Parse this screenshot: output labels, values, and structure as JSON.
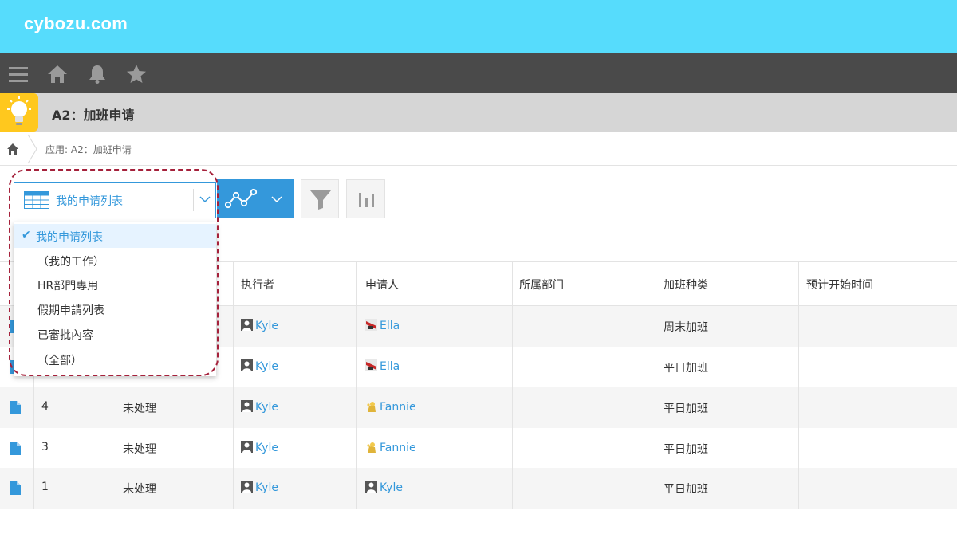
{
  "brand": {
    "logo": "cybozu.com"
  },
  "nav": {
    "icons": [
      "menu-icon",
      "home-icon",
      "bell-icon",
      "star-icon"
    ]
  },
  "app": {
    "title": "A2：加班申请",
    "icon": "lightbulb-icon"
  },
  "breadcrumb": {
    "text": "应用: A2：加班申请"
  },
  "view_selector": {
    "selected": "我的申请列表",
    "options": [
      {
        "label": "我的申请列表",
        "selected": true
      },
      {
        "label": "（我的工作）",
        "selected": false
      },
      {
        "label": "HR部門專用",
        "selected": false
      },
      {
        "label": "假期申請列表",
        "selected": false
      },
      {
        "label": "已審批內容",
        "selected": false
      },
      {
        "label": "（全部）",
        "selected": false
      }
    ]
  },
  "table": {
    "headers": [
      "执行者",
      "申请人",
      "所属部门",
      "加班种类",
      "预计开始时间"
    ],
    "rows": [
      {
        "id": "",
        "status": "",
        "assignee": "Kyle",
        "applicant": "Ella",
        "dept": "",
        "type": "周末加班",
        "start": ""
      },
      {
        "id": "",
        "status": "",
        "assignee": "Kyle",
        "applicant": "Ella",
        "dept": "",
        "type": "平日加班",
        "start": ""
      },
      {
        "id": "4",
        "status": "未处理",
        "assignee": "Kyle",
        "applicant": "Fannie",
        "dept": "",
        "type": "平日加班",
        "start": ""
      },
      {
        "id": "3",
        "status": "未处理",
        "assignee": "Kyle",
        "applicant": "Fannie",
        "dept": "",
        "type": "平日加班",
        "start": ""
      },
      {
        "id": "1",
        "status": "未处理",
        "assignee": "Kyle",
        "applicant": "Kyle",
        "dept": "",
        "type": "平日加班",
        "start": ""
      }
    ]
  },
  "colors": {
    "brand": "#56dcfc",
    "accent": "#3498db",
    "navbar": "#4a4a4a",
    "highlight": "#a5213b"
  }
}
